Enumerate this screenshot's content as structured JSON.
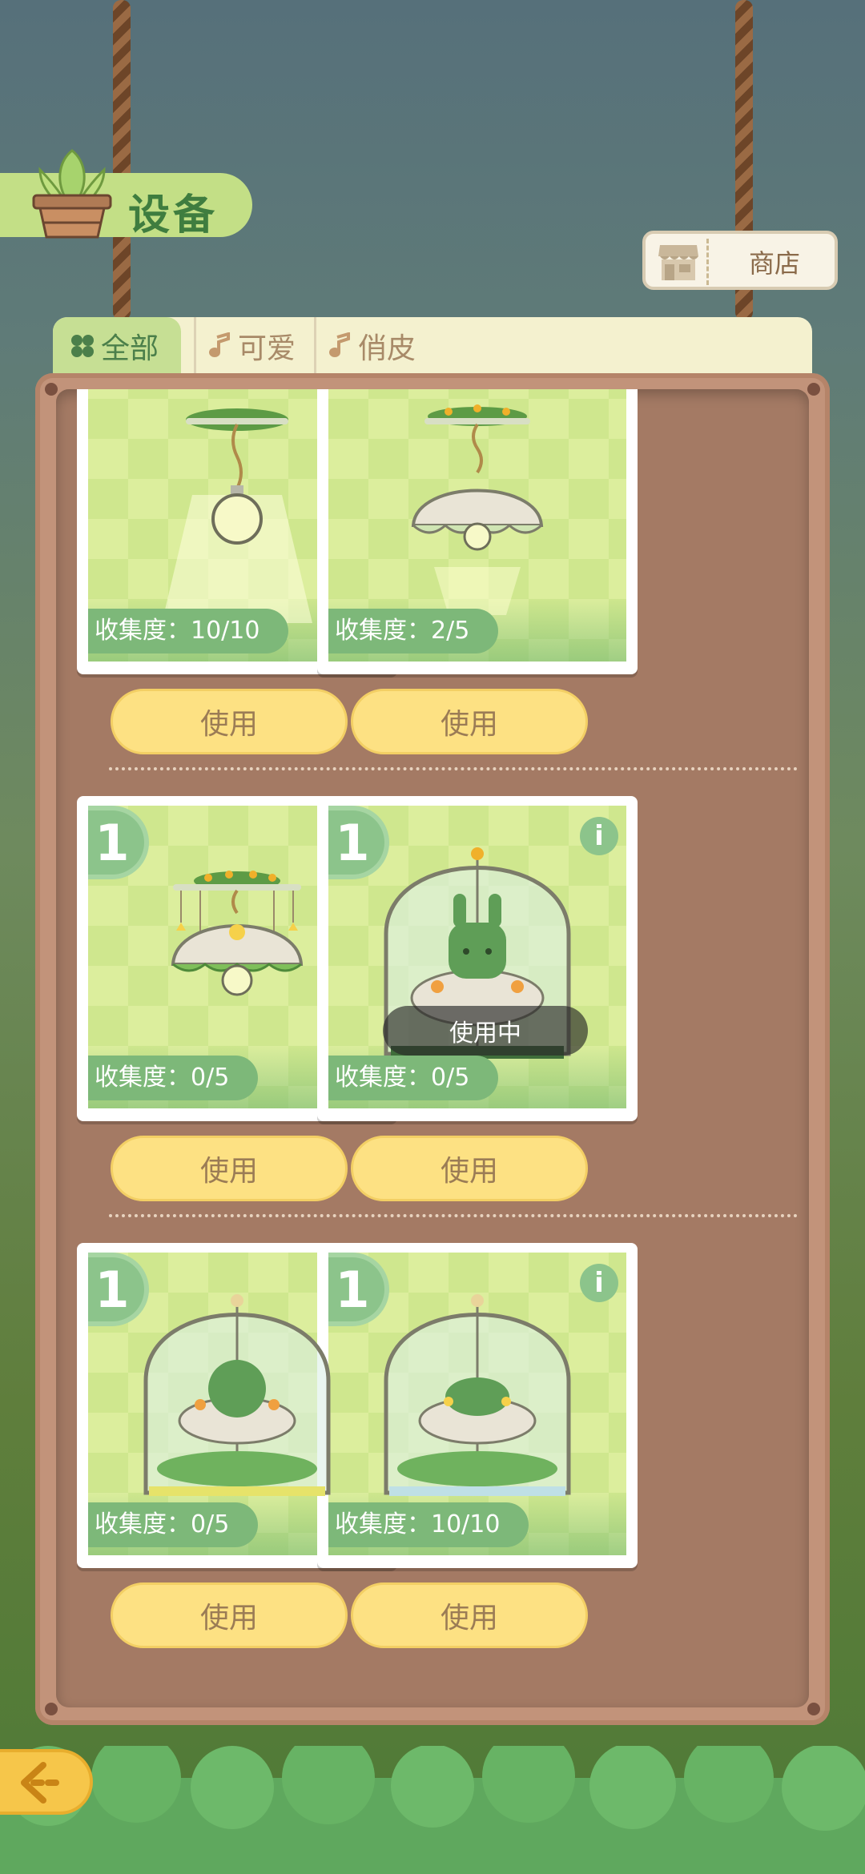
{
  "header": {
    "title": "设备",
    "shop_label": "商店"
  },
  "tabs": [
    {
      "label": "全部",
      "active": true
    },
    {
      "label": "可爱",
      "active": false
    },
    {
      "label": "俏皮",
      "active": false
    }
  ],
  "items": [
    {
      "collection": "收集度：10/10",
      "button": "使用",
      "count": "",
      "status": ""
    },
    {
      "collection": "收集度：2/5",
      "button": "使用",
      "count": "",
      "status": ""
    },
    {
      "collection": "收集度：0/5",
      "button": "使用",
      "count": "1",
      "status": ""
    },
    {
      "collection": "收集度：0/5",
      "button": "使用",
      "count": "1",
      "status": "使用中"
    },
    {
      "collection": "收集度：0/5",
      "button": "使用",
      "count": "1",
      "status": ""
    },
    {
      "collection": "收集度：10/10",
      "button": "使用",
      "count": "1",
      "status": ""
    }
  ],
  "colors": {
    "accent_green": "#8cc48b",
    "button_yellow": "#fde183",
    "board_brown": "#a47a64"
  },
  "icons": [
    "plant-pot-icon",
    "store-icon",
    "clover-icon",
    "music-note-icon",
    "info-icon",
    "back-arrow-icon"
  ]
}
